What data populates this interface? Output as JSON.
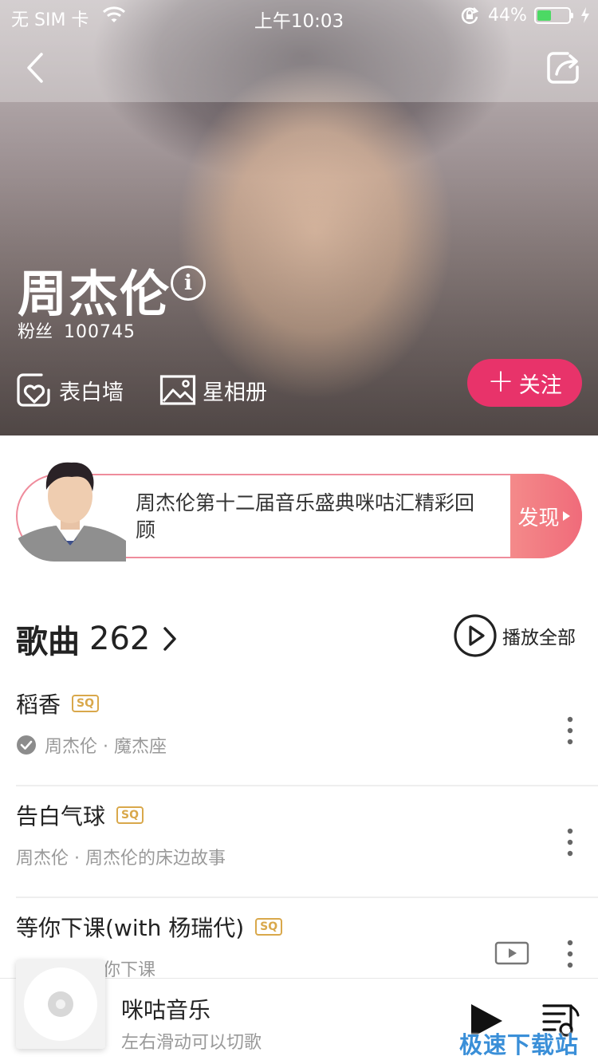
{
  "status_bar": {
    "carrier": "无 SIM 卡",
    "time": "上午10:03",
    "battery_percent": "44%",
    "battery_level": 0.44
  },
  "artist": {
    "name": "周杰伦",
    "fans_label": "粉丝",
    "fans_count": "100745"
  },
  "hero_actions": {
    "confess_wall": "表白墙",
    "album": "星相册",
    "follow": "关注"
  },
  "banner": {
    "text": "周杰伦第十二届音乐盛典咪咕汇精彩回顾",
    "discover": "发现"
  },
  "songs": {
    "title": "歌曲",
    "count": "262",
    "play_all": "播放全部",
    "items": [
      {
        "title": "稻香",
        "quality": "SQ",
        "subtitle": "周杰伦 · 魔杰座"
      },
      {
        "title": "告白气球",
        "quality": "SQ",
        "subtitle": "周杰伦 · 周杰伦的床边故事"
      },
      {
        "title": "等你下课(with 杨瑞代)",
        "quality": "SQ",
        "subtitle": "周杰伦 · 等你下课"
      }
    ]
  },
  "mini_player": {
    "title": "咪咕音乐",
    "subtitle": "左右滑动可以切歌"
  },
  "watermark": "极速下载站",
  "colors": {
    "accent": "#e8336a",
    "sq_badge": "#d9a84b",
    "banner_border": "#ef8c9c",
    "watermark": "#3a8fd8"
  },
  "icons": {
    "back": "chevron-left-icon",
    "share": "share-icon",
    "info": "info-icon",
    "confess_wall": "heart-card-icon",
    "album": "image-icon",
    "songs_arrow": "chevron-right-icon",
    "play_all": "play-circle-icon",
    "downloaded": "check-circle-icon",
    "more": "more-vertical-icon",
    "mv": "video-icon",
    "play": "play-icon",
    "playlist": "playlist-icon"
  }
}
